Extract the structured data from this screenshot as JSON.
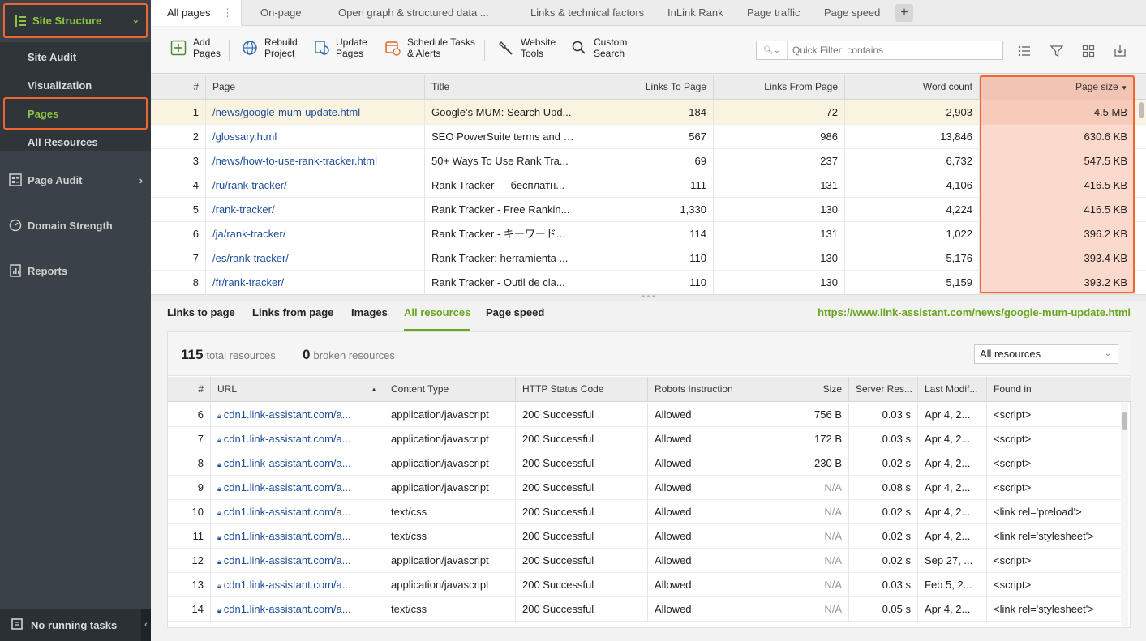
{
  "sidebar": {
    "site_structure": "Site Structure",
    "sub_items": [
      "Site Audit",
      "Visualization",
      "Pages",
      "All Resources"
    ],
    "page_audit": "Page Audit",
    "domain_strength": "Domain Strength",
    "reports": "Reports",
    "no_tasks": "No running tasks"
  },
  "tabs": [
    "All pages",
    "On-page",
    "Open graph & structured data ...",
    "Links & technical factors",
    "InLink Rank",
    "Page traffic",
    "Page speed"
  ],
  "toolbar": {
    "add_pages": [
      "Add",
      "Pages"
    ],
    "rebuild": [
      "Rebuild",
      "Project"
    ],
    "update": [
      "Update",
      "Pages"
    ],
    "schedule": [
      "Schedule Tasks",
      "& Alerts"
    ],
    "website_tools": [
      "Website",
      "Tools"
    ],
    "custom_search": [
      "Custom",
      "Search"
    ],
    "filter_placeholder": "Quick Filter: contains"
  },
  "pages_table": {
    "columns": [
      "#",
      "Page",
      "Title",
      "Links To Page",
      "Links From Page",
      "Word count",
      "Page size"
    ],
    "rows": [
      [
        "1",
        "/news/google-mum-update.html",
        "Google’s MUM: Search Upd...",
        "184",
        "72",
        "2,903",
        "4.5 MB"
      ],
      [
        "2",
        "/glossary.html",
        "SEO PowerSuite terms and f...",
        "567",
        "986",
        "13,846",
        "630.6 KB"
      ],
      [
        "3",
        "/news/how-to-use-rank-tracker.html",
        "50+ Ways To Use Rank Tra...",
        "69",
        "237",
        "6,732",
        "547.5 KB"
      ],
      [
        "4",
        "/ru/rank-tracker/",
        "Rank Tracker — бесплатн...",
        "111",
        "131",
        "4,106",
        "416.5 KB"
      ],
      [
        "5",
        "/rank-tracker/",
        "Rank Tracker - Free Rankin...",
        "1,330",
        "130",
        "4,224",
        "416.5 KB"
      ],
      [
        "6",
        "/ja/rank-tracker/",
        "Rank Tracker - キーワード...",
        "114",
        "131",
        "1,022",
        "396.2 KB"
      ],
      [
        "7",
        "/es/rank-tracker/",
        "Rank Tracker: herramienta ...",
        "110",
        "130",
        "5,176",
        "393.4 KB"
      ],
      [
        "8",
        "/fr/rank-tracker/",
        "Rank Tracker - Outil de cla...",
        "110",
        "130",
        "5,159",
        "393.2 KB"
      ]
    ]
  },
  "bottom_tabs": [
    "Links to page",
    "Links from page",
    "Images",
    "All resources",
    "Page speed"
  ],
  "selected_url": "https://www.link-assistant.com/news/google-mum-update.html",
  "resources": {
    "total": "115",
    "total_label": "total resources",
    "broken": "0",
    "broken_label": "broken resources",
    "filter": "All resources",
    "columns": [
      "#",
      "URL",
      "Content Type",
      "HTTP Status Code",
      "Robots Instruction",
      "Size",
      "Server Res...",
      "Last Modif...",
      "Found in"
    ],
    "rows": [
      [
        "6",
        "cdn1.link-assistant.com/a...",
        "application/javascript",
        "200 Successful",
        "Allowed",
        "756 B",
        "0.03 s",
        "Apr 4, 2...",
        "<script>"
      ],
      [
        "7",
        "cdn1.link-assistant.com/a...",
        "application/javascript",
        "200 Successful",
        "Allowed",
        "172 B",
        "0.03 s",
        "Apr 4, 2...",
        "<script>"
      ],
      [
        "8",
        "cdn1.link-assistant.com/a...",
        "application/javascript",
        "200 Successful",
        "Allowed",
        "230 B",
        "0.02 s",
        "Apr 4, 2...",
        "<script>"
      ],
      [
        "9",
        "cdn1.link-assistant.com/a...",
        "application/javascript",
        "200 Successful",
        "Allowed",
        "N/A",
        "0.08 s",
        "Apr 4, 2...",
        "<script>"
      ],
      [
        "10",
        "cdn1.link-assistant.com/a...",
        "text/css",
        "200 Successful",
        "Allowed",
        "N/A",
        "0.02 s",
        "Apr 4, 2...",
        "<link rel='preload'>"
      ],
      [
        "11",
        "cdn1.link-assistant.com/a...",
        "text/css",
        "200 Successful",
        "Allowed",
        "N/A",
        "0.02 s",
        "Apr 4, 2...",
        "<link rel='stylesheet'>"
      ],
      [
        "12",
        "cdn1.link-assistant.com/a...",
        "application/javascript",
        "200 Successful",
        "Allowed",
        "N/A",
        "0.02 s",
        "Sep 27, ...",
        "<script>"
      ],
      [
        "13",
        "cdn1.link-assistant.com/a...",
        "application/javascript",
        "200 Successful",
        "Allowed",
        "N/A",
        "0.03 s",
        "Feb 5, 2...",
        "<script>"
      ],
      [
        "14",
        "cdn1.link-assistant.com/a...",
        "text/css",
        "200 Successful",
        "Allowed",
        "N/A",
        "0.05 s",
        "Apr 4, 2...",
        "<link rel='stylesheet'>"
      ]
    ]
  },
  "colors": {
    "accent_green": "#6aa51e",
    "highlight_orange": "#f06532",
    "link_blue": "#1e4f9c",
    "sidebar_bg": "#3a4147"
  }
}
